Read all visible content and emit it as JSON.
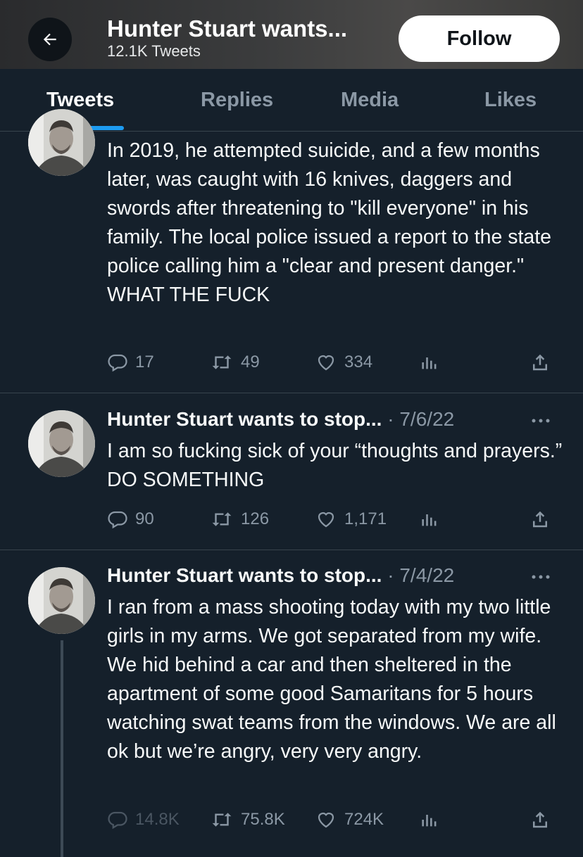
{
  "header": {
    "title": "Hunter Stuart wants...",
    "subtitle": "12.1K Tweets",
    "follow_label": "Follow",
    "back_icon": "arrow-left-icon"
  },
  "tabs": [
    "Tweets",
    "Replies",
    "Media",
    "Likes"
  ],
  "active_tab": "Tweets",
  "colors": {
    "background": "#15202b",
    "accent": "#1d9bf0",
    "muted": "#8b98a5"
  },
  "tweets": [
    {
      "text": "In 2019, he attempted suicide, and a few months later, was caught with 16 knives, daggers and swords after threatening to \"kill everyone\" in his family. The local police issued a report to the state police calling him a \"clear and present danger.\" WHAT THE FUCK",
      "replies": "17",
      "retweets": "49",
      "likes": "334"
    },
    {
      "name": "Hunter Stuart wants to stop...",
      "separator": "·",
      "date": "7/6/22",
      "text": "I am so fucking sick of your “thoughts and prayers.” DO SOMETHING",
      "replies": "90",
      "retweets": "126",
      "likes": "1,171"
    },
    {
      "name": "Hunter Stuart wants to stop...",
      "separator": "·",
      "date": "7/4/22",
      "text": "I ran from a mass shooting today with my two little girls in my arms. We got separated from my wife. We hid behind a car and then sheltered in the apartment of some good Samaritans for 5 hours watching swat teams from the windows. We are all ok but we’re angry, very very angry.",
      "replies": "14.8K",
      "retweets": "75.8K",
      "likes": "724K"
    }
  ]
}
